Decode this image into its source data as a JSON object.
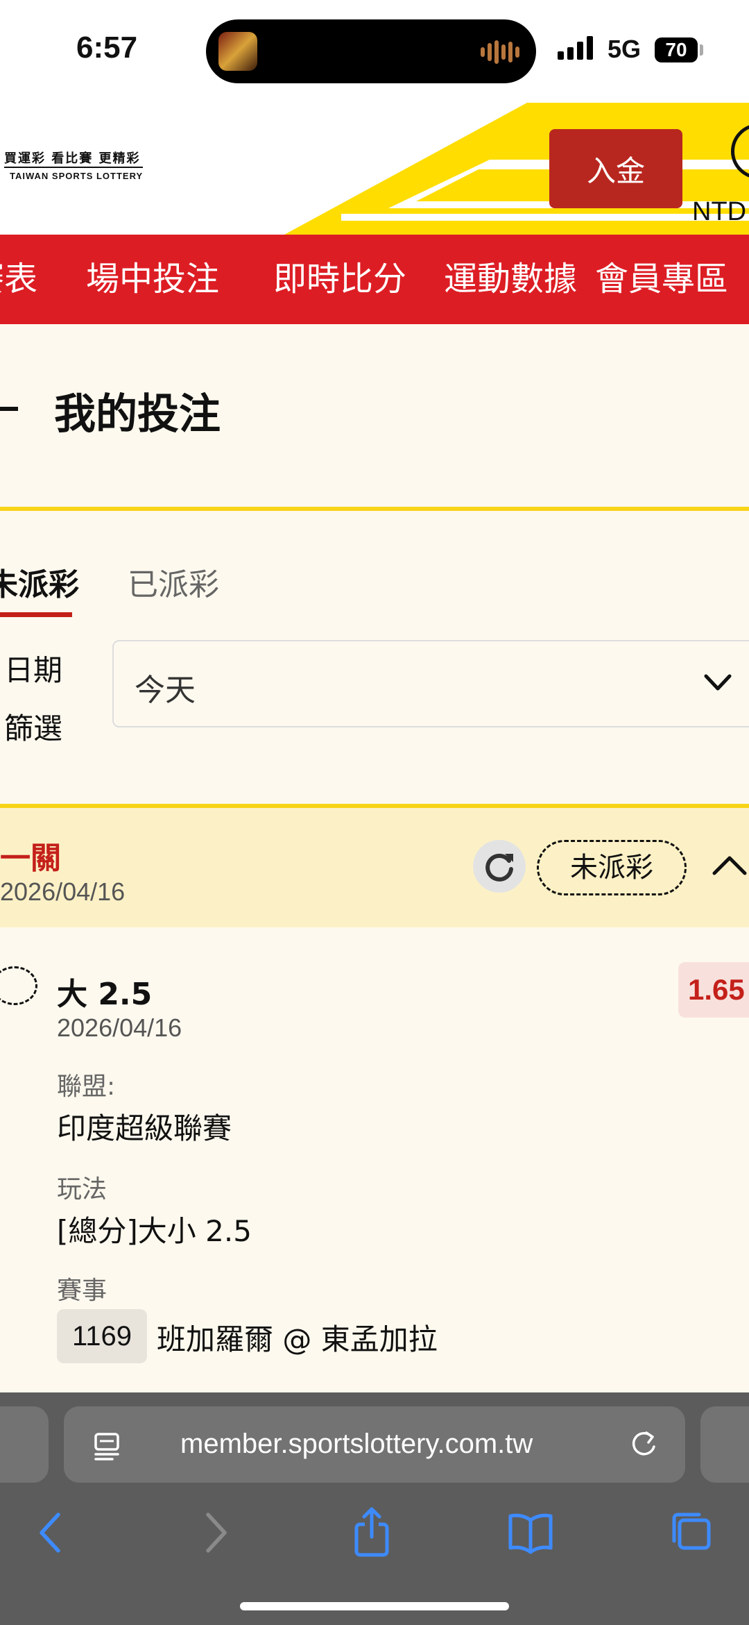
{
  "status_bar": {
    "time": "6:57",
    "network": "5G",
    "battery": "70"
  },
  "header": {
    "logo_zh": "買運彩 看比賽 更精彩",
    "logo_en": "TAIWAN SPORTS LOTTERY",
    "deposit_label": "入金",
    "currency": "NTD"
  },
  "nav": {
    "items": [
      {
        "label": "賽表"
      },
      {
        "label": "場中投注"
      },
      {
        "label": "即時比分"
      },
      {
        "label": "運動數據"
      },
      {
        "label": "會員專區"
      }
    ]
  },
  "page": {
    "title": "我的投注"
  },
  "tabs": {
    "unpaid": "未派彩",
    "paid": "已派彩"
  },
  "filter": {
    "label": "日期篩選",
    "value": "今天"
  },
  "bet": {
    "type": "一關",
    "date": "2026/04/16",
    "status": "未派彩",
    "selection": "大 2.5",
    "selection_date": "2026/04/16",
    "odds": "1.65",
    "league_label": "聯盟:",
    "league": "印度超級聯賽",
    "market_label": "玩法",
    "market": "[總分]大小 2.5",
    "event_label": "賽事",
    "match_no": "1169",
    "match": "班加羅爾 @ 東孟加拉"
  },
  "browser": {
    "url": "member.sportslottery.com.tw"
  },
  "colors": {
    "brand_red": "#DD1D24",
    "accent_yellow": "#F7D417",
    "odds_red": "#C4201A",
    "deposit": "#B8271F"
  }
}
